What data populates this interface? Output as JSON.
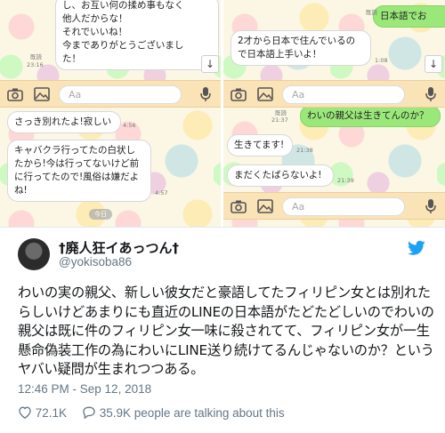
{
  "chat": {
    "composer_placeholder": "Aa",
    "scroll_down_glyph": "↓",
    "top_left": {
      "bubble_text": "し、お互い何の揉め事もなく\n他人だからな！\nそれでいいね！\n今までありがとうございまし\nた！",
      "read_label": "既読",
      "time": "23:16"
    },
    "top_right": {
      "sent_text": "日本語でお",
      "bubble_text": "2才から日本で住んでいるの\nで日本語上手いよ！",
      "read_label": "既読",
      "time": "1:08"
    },
    "bottom_left": {
      "bubble1_text": "さっき別れたよ!寂しい",
      "bubble1_meta": "4:56",
      "bubble2_text": "キャバクラ行ってたの白状し\nたから!今は行ってないけど前\nに行ってたので!風俗は嫌だよ\nね!",
      "bubble2_meta": "4:57",
      "date_pill": "今日"
    },
    "bottom_right": {
      "sent_text": "わいの親父は生きてんのか？",
      "read_label": "既読",
      "sent_time": "21:37",
      "reply1_text": "生きてます!",
      "reply1_time": "21:38",
      "reply2_text": "まだくたばらないよ!",
      "reply2_time": "21:39"
    }
  },
  "tweet": {
    "display_name": "†廃人狂イあっつん†",
    "handle": "@yokisoba86",
    "text": "わいの実の親父、新しい彼女だと豪語してたフィリピン女とは別れたらしいけどあまりにも直近のLINEの日本語がたどたどしいのでわいの親父は既に件のフィリピン女一味に殺されてて、フィリピン女が一生懸命偽装工作の為にわいにLINE送り続けてるんじゃないのか？というヤバい疑問が生まれつつある。",
    "timestamp": "12:46 PM - Sep 12, 2018",
    "likes": "72.1K",
    "replies": "35.9K people are talking about this"
  },
  "colors": {
    "twitter_blue": "#1da1f2",
    "like_red": "#e0245e",
    "line_green": "#9be87a",
    "toolbar_bg": "#fbe3b8"
  },
  "icons": [
    "camera-icon",
    "image-icon",
    "microphone-icon",
    "scroll-down-icon",
    "twitter-bird-icon",
    "heart-icon",
    "reply-bubble-icon"
  ]
}
